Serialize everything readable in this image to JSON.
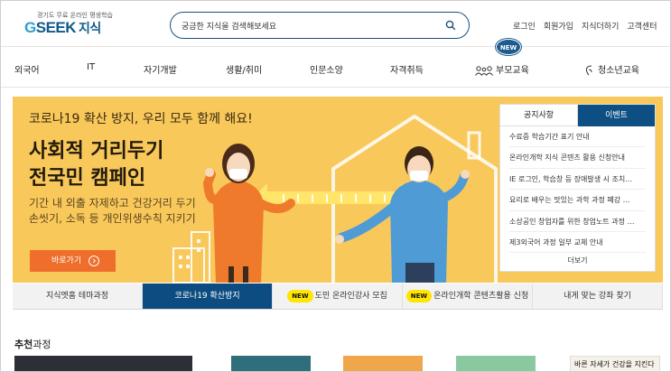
{
  "header": {
    "logo_small": "경기도 무료 온라인 평생학습",
    "logo_g": "G",
    "logo_main": "SEEK",
    "logo_kr": "지식",
    "search_placeholder": "궁금한 지식을 검색해보세요",
    "links": [
      "로그인",
      "회원가입",
      "지식더하기",
      "고객센터"
    ]
  },
  "nav": {
    "items": [
      "외국어",
      "IT",
      "자기개발",
      "생활/취미",
      "인문소양",
      "자격취득",
      "부모교육",
      "청소년교육"
    ],
    "new_badge": "NEW"
  },
  "banner": {
    "line1": "코로나19 확산 방지, 우리 모두 함께 해요!",
    "title1": "사회적 거리두기",
    "title2": "전국민 캠페인",
    "sub1": "기간 내 외출 자제하고 건강거리 두기",
    "sub2": "손씻기, 소독 등 개인위생수칙 지키기",
    "button": "바로가기",
    "colors": {
      "background": "#f8c85a",
      "button": "#ef6e2b"
    }
  },
  "notice": {
    "tabs": [
      "공지사항",
      "이벤트"
    ],
    "items": [
      "수료증 학습기간 표기 안내",
      "온라인개학 지식 콘텐츠 활용 신청안내",
      "IE 로그인, 학습창 등 장애발생 시 조치…",
      "요리로 배우는 맛있는 과학 과정 폐강 …",
      "소상공인 창업자를 위한 창업노트 과정 …",
      "제3외국어 과정 일부 교체 안내"
    ],
    "more": "더보기"
  },
  "banner_tabs": [
    {
      "label": "지식멧홈 테마과정",
      "new": false,
      "new_label": ""
    },
    {
      "label": "코로나19 확산방지",
      "new": false,
      "new_label": ""
    },
    {
      "label": "도민 온라인강사 모집",
      "new": true,
      "new_label": "NEW"
    },
    {
      "label": "온라인개학 콘텐츠활용 신청",
      "new": true,
      "new_label": "NEW"
    },
    {
      "label": "내게 맞는 강좌 찾기",
      "new": false,
      "new_label": ""
    }
  ],
  "recommend": {
    "title_bold": "추천",
    "title_rest": "과정",
    "thumb_text": "바른 자세가 건강을 지킨다"
  }
}
